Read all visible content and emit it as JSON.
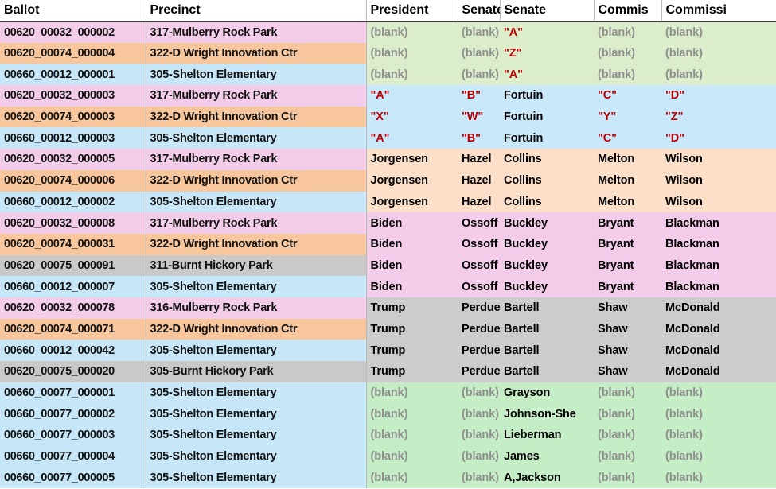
{
  "table": {
    "headers": [
      {
        "label": "Ballot",
        "name": "column-header-ballot"
      },
      {
        "label": "Precinct",
        "name": "column-header-precinct"
      },
      {
        "label": "President",
        "name": "column-header-president"
      },
      {
        "label": "Senate",
        "name": "column-header-senate-1"
      },
      {
        "label": "Senate",
        "name": "column-header-senate-2"
      },
      {
        "label": "Commis",
        "name": "column-header-commission-1"
      },
      {
        "label": "Commissi",
        "name": "column-header-commission-2"
      }
    ],
    "rows": [
      {
        "ballot": "00620_00032_000002",
        "precinct": "317-Mulberry Rock Park",
        "president": "(blank)",
        "senate1": "(blank)",
        "senate2": "\"A\"",
        "comm1": "(blank)",
        "comm2": "(blank)",
        "left_bg": "bg-pink",
        "vote_bg": "vg-lgreen",
        "president_style": "v-blank",
        "senate1_style": "v-blank",
        "senate2_style": "v-quoted",
        "comm1_style": "v-blank",
        "comm2_style": "v-blank"
      },
      {
        "ballot": "00620_00074_000004",
        "precinct": "322-D Wright Innovation Ctr",
        "president": "(blank)",
        "senate1": "(blank)",
        "senate2": "\"Z\"",
        "comm1": "(blank)",
        "comm2": "(blank)",
        "left_bg": "bg-peach",
        "vote_bg": "vg-lgreen",
        "president_style": "v-blank",
        "senate1_style": "v-blank",
        "senate2_style": "v-quoted",
        "comm1_style": "v-blank",
        "comm2_style": "v-blank"
      },
      {
        "ballot": "00660_00012_000001",
        "precinct": "305-Shelton Elementary",
        "president": "(blank)",
        "senate1": "(blank)",
        "senate2": "\"A\"",
        "comm1": "(blank)",
        "comm2": "(blank)",
        "left_bg": "bg-blue",
        "vote_bg": "vg-lgreen",
        "president_style": "v-blank",
        "senate1_style": "v-blank",
        "senate2_style": "v-quoted",
        "comm1_style": "v-blank",
        "comm2_style": "v-blank"
      },
      {
        "ballot": "00620_00032_000003",
        "precinct": "317-Mulberry Rock Park",
        "president": "\"A\"",
        "senate1": "\"B\"",
        "senate2": "Fortuin",
        "comm1": "\"C\"",
        "comm2": "\"D\"",
        "left_bg": "bg-pink",
        "vote_bg": "vg-lblue",
        "president_style": "v-quoted",
        "senate1_style": "v-quoted",
        "senate2_style": "v-name",
        "comm1_style": "v-quoted",
        "comm2_style": "v-quoted"
      },
      {
        "ballot": "00620_00074_000003",
        "precinct": "322-D Wright Innovation Ctr",
        "president": "\"X\"",
        "senate1": "\"W\"",
        "senate2": "Fortuin",
        "comm1": "\"Y\"",
        "comm2": "\"Z\"",
        "left_bg": "bg-peach",
        "vote_bg": "vg-lblue",
        "president_style": "v-quoted",
        "senate1_style": "v-quoted",
        "senate2_style": "v-name",
        "comm1_style": "v-quoted",
        "comm2_style": "v-quoted"
      },
      {
        "ballot": "00660_00012_000003",
        "precinct": "305-Shelton Elementary",
        "president": "\"A\"",
        "senate1": "\"B\"",
        "senate2": "Fortuin",
        "comm1": "\"C\"",
        "comm2": "\"D\"",
        "left_bg": "bg-blue",
        "vote_bg": "vg-lblue",
        "president_style": "v-quoted",
        "senate1_style": "v-quoted",
        "senate2_style": "v-name",
        "comm1_style": "v-quoted",
        "comm2_style": "v-quoted"
      },
      {
        "ballot": "00620_00032_000005",
        "precinct": "317-Mulberry Rock Park",
        "president": "Jorgensen",
        "senate1": "Hazel",
        "senate2": "Collins",
        "comm1": "Melton",
        "comm2": "Wilson",
        "left_bg": "bg-pink",
        "vote_bg": "vg-peach",
        "president_style": "v-name",
        "senate1_style": "v-name",
        "senate2_style": "v-name",
        "comm1_style": "v-name",
        "comm2_style": "v-name"
      },
      {
        "ballot": "00620_00074_000006",
        "precinct": "322-D Wright Innovation Ctr",
        "president": "Jorgensen",
        "senate1": "Hazel",
        "senate2": "Collins",
        "comm1": "Melton",
        "comm2": "Wilson",
        "left_bg": "bg-peach",
        "vote_bg": "vg-peach",
        "president_style": "v-name",
        "senate1_style": "v-name",
        "senate2_style": "v-name",
        "comm1_style": "v-name",
        "comm2_style": "v-name"
      },
      {
        "ballot": "00660_00012_000002",
        "precinct": "305-Shelton Elementary",
        "president": "Jorgensen",
        "senate1": "Hazel",
        "senate2": "Collins",
        "comm1": "Melton",
        "comm2": "Wilson",
        "left_bg": "bg-blue",
        "vote_bg": "vg-peach",
        "president_style": "v-name",
        "senate1_style": "v-name",
        "senate2_style": "v-name",
        "comm1_style": "v-name",
        "comm2_style": "v-name"
      },
      {
        "ballot": "00620_00032_000008",
        "precinct": "317-Mulberry Rock Park",
        "president": "Biden",
        "senate1": "Ossoff",
        "senate2": "Buckley",
        "comm1": "Bryant",
        "comm2": "Blackman",
        "left_bg": "bg-pink",
        "vote_bg": "vg-pink",
        "president_style": "v-name",
        "senate1_style": "v-name",
        "senate2_style": "v-name",
        "comm1_style": "v-name",
        "comm2_style": "v-name"
      },
      {
        "ballot": "00620_00074_000031",
        "precinct": "322-D Wright Innovation Ctr",
        "president": "Biden",
        "senate1": "Ossoff",
        "senate2": "Buckley",
        "comm1": "Bryant",
        "comm2": "Blackman",
        "left_bg": "bg-peach",
        "vote_bg": "vg-pink",
        "president_style": "v-name",
        "senate1_style": "v-name",
        "senate2_style": "v-name",
        "comm1_style": "v-name",
        "comm2_style": "v-name"
      },
      {
        "ballot": "00620_00075_000091",
        "precinct": "311-Burnt Hickory Park",
        "president": "Biden",
        "senate1": "Ossoff",
        "senate2": "Buckley",
        "comm1": "Bryant",
        "comm2": "Blackman",
        "left_bg": "bg-gray",
        "vote_bg": "vg-pink",
        "president_style": "v-name",
        "senate1_style": "v-name",
        "senate2_style": "v-name",
        "comm1_style": "v-name",
        "comm2_style": "v-name"
      },
      {
        "ballot": "00660_00012_000007",
        "precinct": "305-Shelton Elementary",
        "president": "Biden",
        "senate1": "Ossoff",
        "senate2": "Buckley",
        "comm1": "Bryant",
        "comm2": "Blackman",
        "left_bg": "bg-blue",
        "vote_bg": "vg-pink",
        "president_style": "v-name",
        "senate1_style": "v-name",
        "senate2_style": "v-name",
        "comm1_style": "v-name",
        "comm2_style": "v-name"
      },
      {
        "ballot": "00620_00032_000078",
        "precinct": "316-Mulberry Rock Park",
        "president": "Trump",
        "senate1": "Perdue",
        "senate2": "Bartell",
        "comm1": "Shaw",
        "comm2": "McDonald",
        "left_bg": "bg-pink",
        "vote_bg": "vg-gray",
        "president_style": "v-name",
        "senate1_style": "v-name",
        "senate2_style": "v-name",
        "comm1_style": "v-name",
        "comm2_style": "v-name"
      },
      {
        "ballot": "00620_00074_000071",
        "precinct": "322-D Wright Innovation Ctr",
        "president": "Trump",
        "senate1": "Perdue",
        "senate2": "Bartell",
        "comm1": "Shaw",
        "comm2": "McDonald",
        "left_bg": "bg-peach",
        "vote_bg": "vg-gray",
        "president_style": "v-name",
        "senate1_style": "v-name",
        "senate2_style": "v-name",
        "comm1_style": "v-name",
        "comm2_style": "v-name"
      },
      {
        "ballot": "00660_00012_000042",
        "precinct": "305-Shelton Elementary",
        "president": "Trump",
        "senate1": "Perdue",
        "senate2": "Bartell",
        "comm1": "Shaw",
        "comm2": "McDonald",
        "left_bg": "bg-blue",
        "vote_bg": "vg-gray",
        "president_style": "v-name",
        "senate1_style": "v-name",
        "senate2_style": "v-name",
        "comm1_style": "v-name",
        "comm2_style": "v-name"
      },
      {
        "ballot": "00620_00075_000020",
        "precinct": "305-Burnt Hickory Park",
        "president": "Trump",
        "senate1": "Perdue",
        "senate2": "Bartell",
        "comm1": "Shaw",
        "comm2": "McDonald",
        "left_bg": "bg-gray",
        "vote_bg": "vg-gray",
        "president_style": "v-name",
        "senate1_style": "v-name",
        "senate2_style": "v-name",
        "comm1_style": "v-name",
        "comm2_style": "v-name"
      },
      {
        "ballot": "00660_00077_000001",
        "precinct": "305-Shelton Elementary",
        "president": "(blank)",
        "senate1": "(blank)",
        "senate2": "Grayson",
        "comm1": "(blank)",
        "comm2": "(blank)",
        "left_bg": "bg-blue",
        "vote_bg": "vg-green",
        "president_style": "v-blank",
        "senate1_style": "v-blank",
        "senate2_style": "v-name",
        "comm1_style": "v-blank",
        "comm2_style": "v-blank"
      },
      {
        "ballot": "00660_00077_000002",
        "precinct": "305-Shelton Elementary",
        "president": "(blank)",
        "senate1": "(blank)",
        "senate2": "Johnson-She",
        "comm1": "(blank)",
        "comm2": "(blank)",
        "left_bg": "bg-blue",
        "vote_bg": "vg-green",
        "president_style": "v-blank",
        "senate1_style": "v-blank",
        "senate2_style": "v-name",
        "comm1_style": "v-blank",
        "comm2_style": "v-blank"
      },
      {
        "ballot": "00660_00077_000003",
        "precinct": "305-Shelton Elementary",
        "president": "(blank)",
        "senate1": "(blank)",
        "senate2": "Lieberman",
        "comm1": "(blank)",
        "comm2": "(blank)",
        "left_bg": "bg-blue",
        "vote_bg": "vg-green",
        "president_style": "v-blank",
        "senate1_style": "v-blank",
        "senate2_style": "v-name",
        "comm1_style": "v-blank",
        "comm2_style": "v-blank"
      },
      {
        "ballot": "00660_00077_000004",
        "precinct": "305-Shelton Elementary",
        "president": "(blank)",
        "senate1": "(blank)",
        "senate2": "James",
        "comm1": "(blank)",
        "comm2": "(blank)",
        "left_bg": "bg-blue",
        "vote_bg": "vg-green",
        "president_style": "v-blank",
        "senate1_style": "v-blank",
        "senate2_style": "v-name",
        "comm1_style": "v-blank",
        "comm2_style": "v-blank"
      },
      {
        "ballot": "00660_00077_000005",
        "precinct": "305-Shelton Elementary",
        "president": "(blank)",
        "senate1": "(blank)",
        "senate2": "A,Jackson",
        "comm1": "(blank)",
        "comm2": "(blank)",
        "left_bg": "bg-blue",
        "vote_bg": "vg-green",
        "president_style": "v-blank",
        "senate1_style": "v-blank",
        "senate2_style": "v-name",
        "comm1_style": "v-blank",
        "comm2_style": "v-blank"
      }
    ]
  },
  "colors": {
    "pink": "#f3ccea",
    "peach": "#f7c69c",
    "blue": "#c7e7f8",
    "gray": "#c9c9c9",
    "vote_light_green": "#dcedcb",
    "vote_light_blue": "#c9e8f9",
    "vote_peach": "#fbdfc8",
    "vote_pink": "#f3ccea",
    "vote_gray": "#cccccc",
    "vote_green": "#c6eec6",
    "quoted_text": "#c00000",
    "blank_text": "#8f8f8f",
    "header_text": "#000000"
  }
}
